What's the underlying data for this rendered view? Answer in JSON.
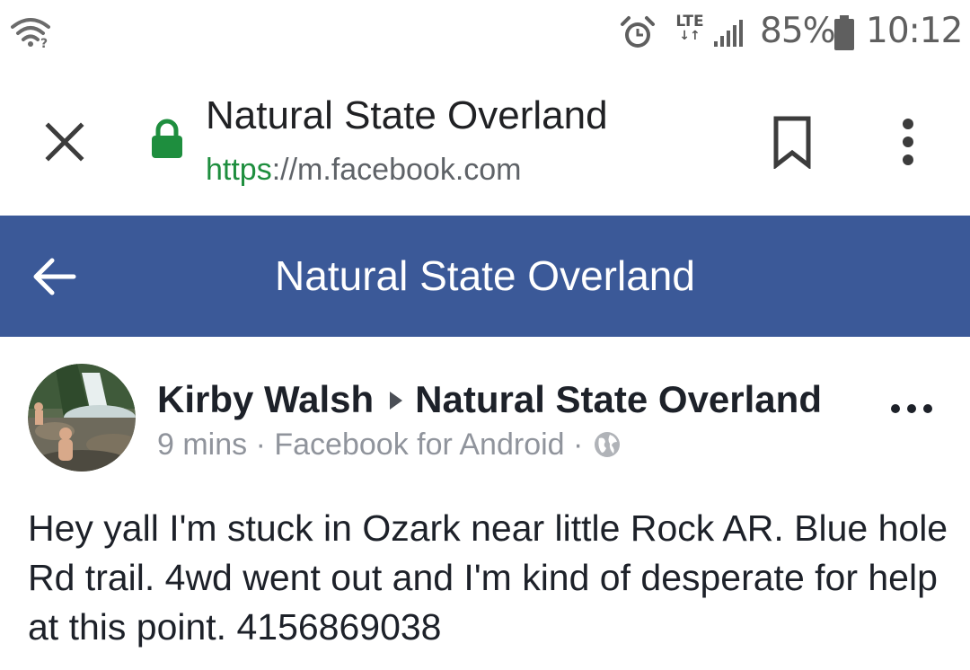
{
  "status_bar": {
    "network_label": "LTE",
    "battery_percent": "85%",
    "time": "10:12",
    "icons": [
      "wifi-icon",
      "alarm-icon",
      "lte-icon",
      "signal-icon",
      "battery-icon"
    ]
  },
  "custom_tab": {
    "title": "Natural State Overland",
    "url_scheme": "https",
    "url_rest": "://m.facebook.com",
    "icons": [
      "close-icon",
      "lock-icon",
      "bookmark-icon",
      "more-vert-icon"
    ],
    "lock_color": "#1e8e3e"
  },
  "fb_header": {
    "title": "Natural State Overland",
    "background": "#3b5998"
  },
  "post": {
    "author": "Kirby Walsh",
    "group": "Natural State Overland",
    "time": "9 mins",
    "separator": "·",
    "source": "Facebook for Android",
    "body": "Hey yall I'm stuck in Ozark near little Rock AR. Blue hole Rd trail. 4wd went out and I'm kind of desperate for help at this point. 4156869038"
  }
}
